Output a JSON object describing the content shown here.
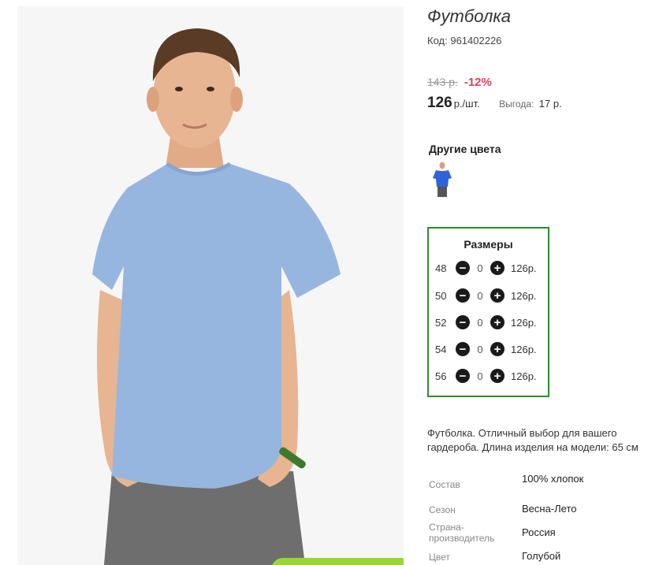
{
  "product": {
    "title": "Футболка",
    "code_label": "Код:",
    "code_value": "961402226",
    "old_price": "143 р.",
    "discount": "-12%",
    "price": "126",
    "price_unit": "р./шт.",
    "benefit_label": "Выгода:",
    "benefit_value": "17 р."
  },
  "colors": {
    "title": "Другие цвета",
    "thumb_color": "#2f63d9"
  },
  "sizes": {
    "title": "Размеры",
    "minus_icon": "minus-circle-icon",
    "plus_icon": "plus-circle-icon",
    "rows": [
      {
        "size": "48",
        "qty": "0",
        "price": "126р."
      },
      {
        "size": "50",
        "qty": "0",
        "price": "126р."
      },
      {
        "size": "52",
        "qty": "0",
        "price": "126р."
      },
      {
        "size": "54",
        "qty": "0",
        "price": "126р."
      },
      {
        "size": "56",
        "qty": "0",
        "price": "126р."
      }
    ]
  },
  "description": "Футболка. Отличный выбор для вашего гардероба. Длина изделия на модели: 65 см",
  "specs": [
    {
      "label": "Состав",
      "value": "100% хлопок"
    },
    {
      "label": "Сезон",
      "value": "Весна-Лето"
    },
    {
      "label": "Страна-производитель",
      "value": "Россия"
    },
    {
      "label": "Цвет",
      "value": "Голубой"
    }
  ],
  "theme": {
    "accent_green": "#2e8b2e",
    "discount_red": "#e2405b",
    "shirt_color": "#97b6df",
    "cart_button": "#9bd43a"
  }
}
